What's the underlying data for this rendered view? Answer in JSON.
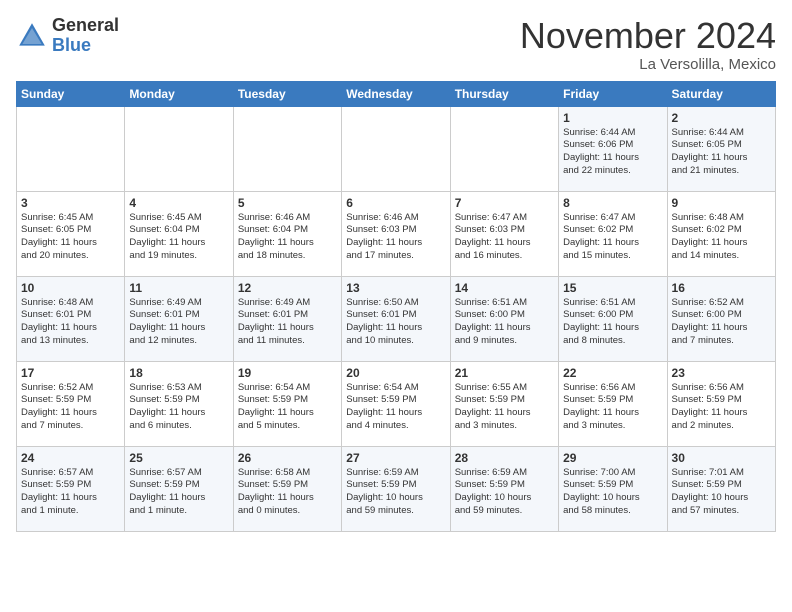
{
  "header": {
    "logo_general": "General",
    "logo_blue": "Blue",
    "month_title": "November 2024",
    "location": "La Versolilla, Mexico"
  },
  "weekdays": [
    "Sunday",
    "Monday",
    "Tuesday",
    "Wednesday",
    "Thursday",
    "Friday",
    "Saturday"
  ],
  "weeks": [
    [
      {
        "day": "",
        "info": ""
      },
      {
        "day": "",
        "info": ""
      },
      {
        "day": "",
        "info": ""
      },
      {
        "day": "",
        "info": ""
      },
      {
        "day": "",
        "info": ""
      },
      {
        "day": "1",
        "info": "Sunrise: 6:44 AM\nSunset: 6:06 PM\nDaylight: 11 hours\nand 22 minutes."
      },
      {
        "day": "2",
        "info": "Sunrise: 6:44 AM\nSunset: 6:05 PM\nDaylight: 11 hours\nand 21 minutes."
      }
    ],
    [
      {
        "day": "3",
        "info": "Sunrise: 6:45 AM\nSunset: 6:05 PM\nDaylight: 11 hours\nand 20 minutes."
      },
      {
        "day": "4",
        "info": "Sunrise: 6:45 AM\nSunset: 6:04 PM\nDaylight: 11 hours\nand 19 minutes."
      },
      {
        "day": "5",
        "info": "Sunrise: 6:46 AM\nSunset: 6:04 PM\nDaylight: 11 hours\nand 18 minutes."
      },
      {
        "day": "6",
        "info": "Sunrise: 6:46 AM\nSunset: 6:03 PM\nDaylight: 11 hours\nand 17 minutes."
      },
      {
        "day": "7",
        "info": "Sunrise: 6:47 AM\nSunset: 6:03 PM\nDaylight: 11 hours\nand 16 minutes."
      },
      {
        "day": "8",
        "info": "Sunrise: 6:47 AM\nSunset: 6:02 PM\nDaylight: 11 hours\nand 15 minutes."
      },
      {
        "day": "9",
        "info": "Sunrise: 6:48 AM\nSunset: 6:02 PM\nDaylight: 11 hours\nand 14 minutes."
      }
    ],
    [
      {
        "day": "10",
        "info": "Sunrise: 6:48 AM\nSunset: 6:01 PM\nDaylight: 11 hours\nand 13 minutes."
      },
      {
        "day": "11",
        "info": "Sunrise: 6:49 AM\nSunset: 6:01 PM\nDaylight: 11 hours\nand 12 minutes."
      },
      {
        "day": "12",
        "info": "Sunrise: 6:49 AM\nSunset: 6:01 PM\nDaylight: 11 hours\nand 11 minutes."
      },
      {
        "day": "13",
        "info": "Sunrise: 6:50 AM\nSunset: 6:01 PM\nDaylight: 11 hours\nand 10 minutes."
      },
      {
        "day": "14",
        "info": "Sunrise: 6:51 AM\nSunset: 6:00 PM\nDaylight: 11 hours\nand 9 minutes."
      },
      {
        "day": "15",
        "info": "Sunrise: 6:51 AM\nSunset: 6:00 PM\nDaylight: 11 hours\nand 8 minutes."
      },
      {
        "day": "16",
        "info": "Sunrise: 6:52 AM\nSunset: 6:00 PM\nDaylight: 11 hours\nand 7 minutes."
      }
    ],
    [
      {
        "day": "17",
        "info": "Sunrise: 6:52 AM\nSunset: 5:59 PM\nDaylight: 11 hours\nand 7 minutes."
      },
      {
        "day": "18",
        "info": "Sunrise: 6:53 AM\nSunset: 5:59 PM\nDaylight: 11 hours\nand 6 minutes."
      },
      {
        "day": "19",
        "info": "Sunrise: 6:54 AM\nSunset: 5:59 PM\nDaylight: 11 hours\nand 5 minutes."
      },
      {
        "day": "20",
        "info": "Sunrise: 6:54 AM\nSunset: 5:59 PM\nDaylight: 11 hours\nand 4 minutes."
      },
      {
        "day": "21",
        "info": "Sunrise: 6:55 AM\nSunset: 5:59 PM\nDaylight: 11 hours\nand 3 minutes."
      },
      {
        "day": "22",
        "info": "Sunrise: 6:56 AM\nSunset: 5:59 PM\nDaylight: 11 hours\nand 3 minutes."
      },
      {
        "day": "23",
        "info": "Sunrise: 6:56 AM\nSunset: 5:59 PM\nDaylight: 11 hours\nand 2 minutes."
      }
    ],
    [
      {
        "day": "24",
        "info": "Sunrise: 6:57 AM\nSunset: 5:59 PM\nDaylight: 11 hours\nand 1 minute."
      },
      {
        "day": "25",
        "info": "Sunrise: 6:57 AM\nSunset: 5:59 PM\nDaylight: 11 hours\nand 1 minute."
      },
      {
        "day": "26",
        "info": "Sunrise: 6:58 AM\nSunset: 5:59 PM\nDaylight: 11 hours\nand 0 minutes."
      },
      {
        "day": "27",
        "info": "Sunrise: 6:59 AM\nSunset: 5:59 PM\nDaylight: 10 hours\nand 59 minutes."
      },
      {
        "day": "28",
        "info": "Sunrise: 6:59 AM\nSunset: 5:59 PM\nDaylight: 10 hours\nand 59 minutes."
      },
      {
        "day": "29",
        "info": "Sunrise: 7:00 AM\nSunset: 5:59 PM\nDaylight: 10 hours\nand 58 minutes."
      },
      {
        "day": "30",
        "info": "Sunrise: 7:01 AM\nSunset: 5:59 PM\nDaylight: 10 hours\nand 57 minutes."
      }
    ]
  ]
}
